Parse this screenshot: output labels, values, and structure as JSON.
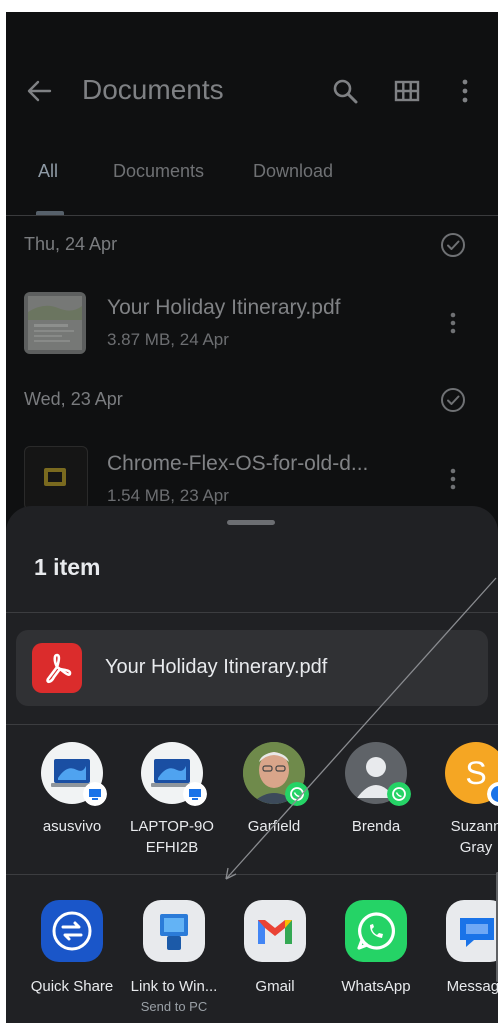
{
  "appbar": {
    "title": "Documents",
    "back_icon": "arrow-back-icon",
    "search_icon": "search-icon",
    "grid_icon": "grid-view-icon",
    "more_icon": "more-vert-icon"
  },
  "tabs": [
    {
      "label": "All",
      "active": true
    },
    {
      "label": "Documents",
      "active": false
    },
    {
      "label": "Download",
      "active": false
    }
  ],
  "groups": [
    {
      "date": "Thu, 24 Apr",
      "file": {
        "name": "Your Holiday Itinerary.pdf",
        "meta": "3.87 MB, 24 Apr"
      }
    },
    {
      "date": "Wed, 23 Apr",
      "file": {
        "name": "Chrome-Flex-OS-for-old-d...",
        "meta": "1.54 MB, 23 Apr"
      }
    }
  ],
  "sheet": {
    "title": "1 item",
    "file_name": "Your Holiday Itinerary.pdf",
    "contacts": [
      {
        "name": "asusvivo",
        "badge": "windows-link-badge"
      },
      {
        "name": "LAPTOP-9O EFHI2B",
        "badge": "windows-link-badge"
      },
      {
        "name": "Garfield",
        "badge": "whatsapp-badge"
      },
      {
        "name": "Brenda",
        "badge": "whatsapp-badge"
      },
      {
        "name": "Suzann Gray",
        "initial": "S",
        "badge": "messages-badge"
      }
    ],
    "apps": [
      {
        "name": "Quick Share",
        "sub": ""
      },
      {
        "name": "Link to Win...",
        "sub": "Send to PC"
      },
      {
        "name": "Gmail",
        "sub": ""
      },
      {
        "name": "WhatsApp",
        "sub": ""
      },
      {
        "name": "Message",
        "sub": ""
      }
    ]
  },
  "colors": {
    "sheet_bg": "#202124",
    "pdf_red": "#db2c2c",
    "quick_share_blue": "#1a73e8",
    "whatsapp_green": "#25d366",
    "suzann_avatar": "#f5a623"
  }
}
